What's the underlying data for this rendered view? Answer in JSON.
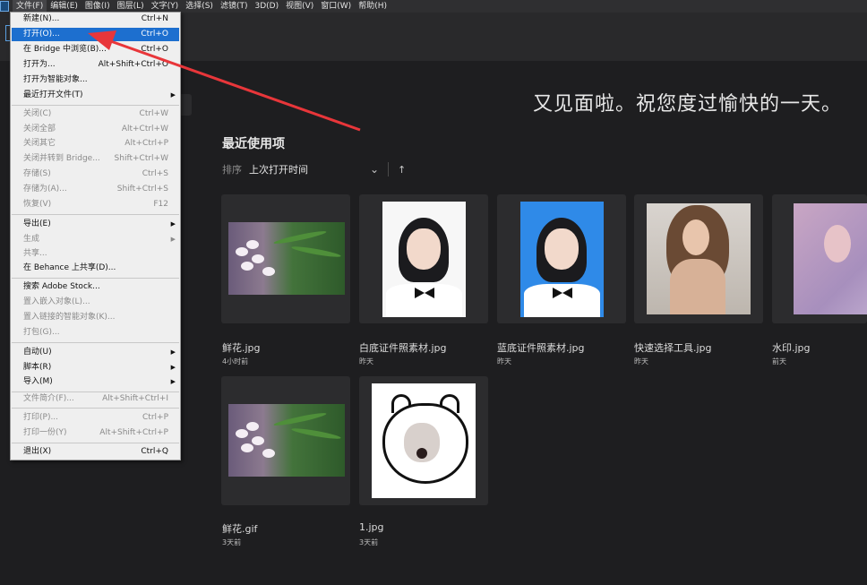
{
  "menubar": {
    "items": [
      "文件(F)",
      "编辑(E)",
      "图像(I)",
      "图层(L)",
      "文字(Y)",
      "选择(S)",
      "滤镜(T)",
      "3D(D)",
      "视图(V)",
      "窗口(W)",
      "帮助(H)"
    ]
  },
  "home": {
    "greeting": "又见面啦。祝您度过愉快的一天。",
    "recent_title": "最近使用项",
    "sort_label": "排序",
    "sort_value": "上次打开时间",
    "sort_dir": "↑"
  },
  "recent_files": [
    {
      "name": "鲜花.jpg",
      "time": "4小时前"
    },
    {
      "name": "白底证件照素材.jpg",
      "time": "昨天"
    },
    {
      "name": "蓝底证件照素材.jpg",
      "time": "昨天"
    },
    {
      "name": "快速选择工具.jpg",
      "time": "昨天"
    },
    {
      "name": "水印.jpg",
      "time": "前天"
    },
    {
      "name": "鲜花.gif",
      "time": "3天前"
    },
    {
      "name": "1.jpg",
      "time": "3天前"
    }
  ],
  "file_menu": {
    "new": {
      "label": "新建(N)...",
      "shortcut": "Ctrl+N"
    },
    "open": {
      "label": "打开(O)...",
      "shortcut": "Ctrl+O"
    },
    "bridge": {
      "label": "在 Bridge 中浏览(B)...",
      "shortcut": "Ctrl+O"
    },
    "open_as": {
      "label": "打开为...",
      "shortcut": "Alt+Shift+Ctrl+O"
    },
    "open_smart": {
      "label": "打开为智能对象..."
    },
    "recent": {
      "label": "最近打开文件(T)"
    },
    "close": {
      "label": "关闭(C)",
      "shortcut": "Ctrl+W"
    },
    "close_all": {
      "label": "关闭全部",
      "shortcut": "Alt+Ctrl+W"
    },
    "close_others": {
      "label": "关闭其它",
      "shortcut": "Alt+Ctrl+P"
    },
    "close_bridge": {
      "label": "关闭并转到 Bridge...",
      "shortcut": "Shift+Ctrl+W"
    },
    "save": {
      "label": "存储(S)",
      "shortcut": "Ctrl+S"
    },
    "save_as": {
      "label": "存储为(A)...",
      "shortcut": "Shift+Ctrl+S"
    },
    "revert": {
      "label": "恢复(V)",
      "shortcut": "F12"
    },
    "export": {
      "label": "导出(E)"
    },
    "generate": {
      "label": "生成"
    },
    "share": {
      "label": "共享..."
    },
    "behance": {
      "label": "在 Behance 上共享(D)..."
    },
    "stock": {
      "label": "搜索 Adobe Stock..."
    },
    "place_embed": {
      "label": "置入嵌入对象(L)..."
    },
    "place_link": {
      "label": "置入链接的智能对象(K)..."
    },
    "package": {
      "label": "打包(G)..."
    },
    "automate": {
      "label": "自动(U)"
    },
    "scripts": {
      "label": "脚本(R)"
    },
    "import": {
      "label": "导入(M)"
    },
    "file_info": {
      "label": "文件简介(F)...",
      "shortcut": "Alt+Shift+Ctrl+I"
    },
    "print": {
      "label": "打印(P)...",
      "shortcut": "Ctrl+P"
    },
    "print_one": {
      "label": "打印一份(Y)",
      "shortcut": "Alt+Shift+Ctrl+P"
    },
    "exit": {
      "label": "退出(X)",
      "shortcut": "Ctrl+Q"
    }
  }
}
